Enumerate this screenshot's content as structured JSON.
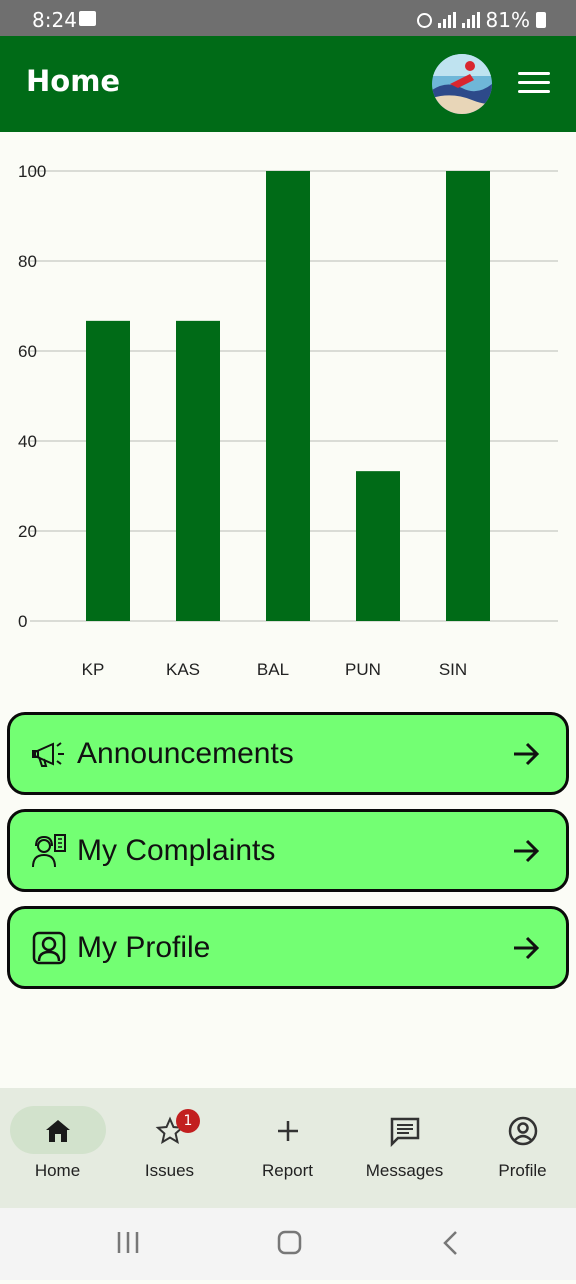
{
  "status_bar": {
    "time": "8:24",
    "battery": "81%"
  },
  "app_bar": {
    "title": "Home"
  },
  "chart_data": {
    "type": "bar",
    "categories": [
      "KP",
      "KAS",
      "BAL",
      "PUN",
      "SIN"
    ],
    "values": [
      66.7,
      66.7,
      100,
      33.3,
      100
    ],
    "ylim": [
      0,
      100
    ],
    "yticks": [
      "0",
      "20",
      "40",
      "60",
      "80",
      "100"
    ],
    "grid": true,
    "bar_color": "#006b17"
  },
  "cards": [
    {
      "label": "Announcements",
      "icon": "megaphone-icon"
    },
    {
      "label": "My Complaints",
      "icon": "support-agent-icon"
    },
    {
      "label": "My Profile",
      "icon": "profile-badge-icon"
    }
  ],
  "bottom_nav": {
    "items": [
      {
        "label": "Home",
        "icon": "home-icon",
        "active": true
      },
      {
        "label": "Issues",
        "icon": "star-icon",
        "badge": "1"
      },
      {
        "label": "Report",
        "icon": "plus-icon"
      },
      {
        "label": "Messages",
        "icon": "message-icon"
      },
      {
        "label": "Profile",
        "icon": "account-circle-icon"
      }
    ]
  },
  "colors": {
    "primary": "#006b17",
    "card": "#73ff73",
    "badge": "#c21f1f"
  }
}
